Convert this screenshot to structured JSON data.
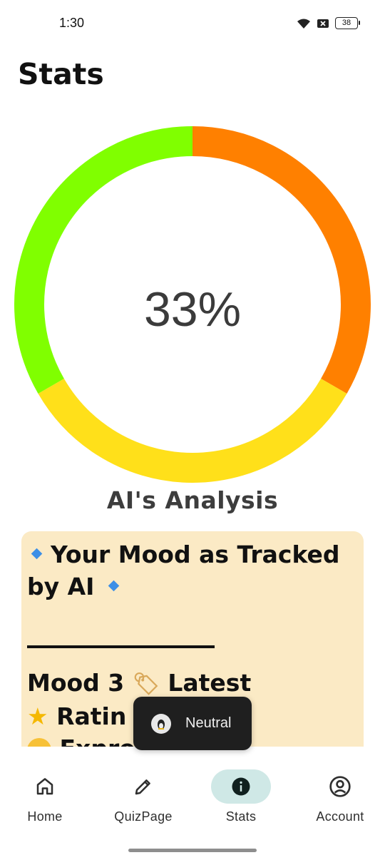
{
  "status_bar": {
    "time": "1:30",
    "battery": "38"
  },
  "page": {
    "title": "Stats"
  },
  "gauge": {
    "value_text": "33%",
    "segments": [
      {
        "label": "orange",
        "color": "#ff8000",
        "start_deg": 0,
        "end_deg": 120
      },
      {
        "label": "yellow",
        "color": "#ffe01a",
        "start_deg": 120,
        "end_deg": 240
      },
      {
        "label": "green",
        "color": "#80ff00",
        "start_deg": 240,
        "end_deg": 360
      }
    ]
  },
  "analysis": {
    "label": "AI's Analysis",
    "card": {
      "heading_line1": "Your Mood as Tracked",
      "heading_line2": "by AI",
      "mood_prefix": "Mood 3",
      "mood_suffix": "Latest",
      "rating_text": "Ratin",
      "expr_text": "Expre"
    }
  },
  "toast": {
    "text": "Neutral"
  },
  "nav": {
    "items": [
      {
        "label": "Home"
      },
      {
        "label": "QuizPage"
      },
      {
        "label": "Stats"
      },
      {
        "label": "Account"
      }
    ],
    "active": "Stats"
  },
  "colors": {
    "card_bg": "#fbeac5",
    "nav_active": "#cfe8e6",
    "toast_bg": "#1f1f1f"
  }
}
